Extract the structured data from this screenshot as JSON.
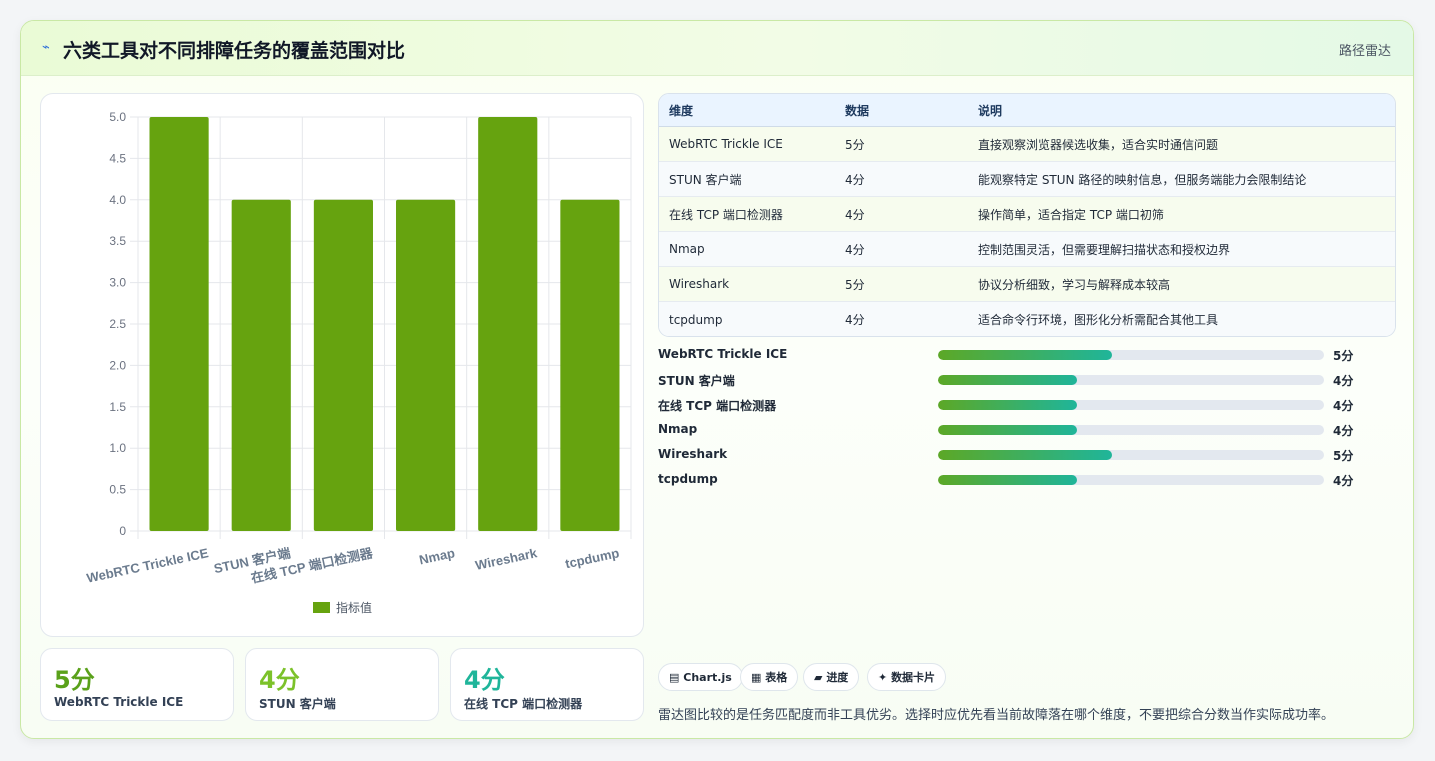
{
  "header": {
    "icon": "sparkle-icon",
    "title": "六类工具对不同排障任务的覆盖范围对比",
    "tag": "路径雷达"
  },
  "chart_data": {
    "type": "bar",
    "categories": [
      "WebRTC Trickle ICE",
      "STUN 客户端",
      "在线 TCP 端口检测器",
      "Nmap",
      "Wireshark",
      "tcpdump"
    ],
    "series": [
      {
        "name": "指标值",
        "values": [
          5,
          4,
          4,
          4,
          5,
          4
        ]
      }
    ],
    "ylim": [
      0,
      5
    ],
    "yticks": [
      "0",
      "0.5",
      "1.0",
      "1.5",
      "2.0",
      "2.5",
      "3.0",
      "3.5",
      "4.0",
      "4.5",
      "5.0"
    ],
    "grid": true,
    "legend": "bottom",
    "color": "#66a30f"
  },
  "table": {
    "headers": [
      "维度",
      "数据",
      "说明"
    ],
    "rows": [
      [
        "WebRTC Trickle ICE",
        "5分",
        "直接观察浏览器候选收集，适合实时通信问题"
      ],
      [
        "STUN 客户端",
        "4分",
        "能观察特定 STUN 路径的映射信息，但服务端能力会限制结论"
      ],
      [
        "在线 TCP 端口检测器",
        "4分",
        "操作简单，适合指定 TCP 端口初筛"
      ],
      [
        "Nmap",
        "4分",
        "控制范围灵活，但需要理解扫描状态和授权边界"
      ],
      [
        "Wireshark",
        "5分",
        "协议分析细致，学习与解释成本较高"
      ],
      [
        "tcpdump",
        "4分",
        "适合命令行环境，图形化分析需配合其他工具"
      ]
    ]
  },
  "progress": [
    {
      "name": "WebRTC Trickle ICE",
      "value": 5,
      "label": "5分",
      "fraction": 0.45
    },
    {
      "name": "STUN 客户端",
      "value": 4,
      "label": "4分",
      "fraction": 0.36
    },
    {
      "name": "在线 TCP 端口检测器",
      "value": 4,
      "label": "4分",
      "fraction": 0.36
    },
    {
      "name": "Nmap",
      "value": 4,
      "label": "4分",
      "fraction": 0.36
    },
    {
      "name": "Wireshark",
      "value": 5,
      "label": "5分",
      "fraction": 0.45
    },
    {
      "name": "tcpdump",
      "value": 4,
      "label": "4分",
      "fraction": 0.36
    }
  ],
  "stats": [
    {
      "value": "5分",
      "label": "WebRTC Trickle ICE",
      "color": "#5aa11a"
    },
    {
      "value": "4分",
      "label": "STUN 客户端",
      "color": "#7cc22a"
    },
    {
      "value": "4分",
      "label": "在线 TCP 端口检测器",
      "color": "#1fb59a"
    }
  ],
  "chips": [
    "Chart.js",
    "表格",
    "进度",
    "数据卡片"
  ],
  "chip_icons": [
    "chart-icon",
    "table-icon",
    "progress-icon",
    "card-icon"
  ],
  "chip_glyphs": [
    "▤",
    "▦",
    "▰",
    "✦"
  ],
  "note": "雷达图比较的是任务匹配度而非工具优劣。选择时应优先看当前故障落在哪个维度，不要把综合分数当作实际成功率。"
}
